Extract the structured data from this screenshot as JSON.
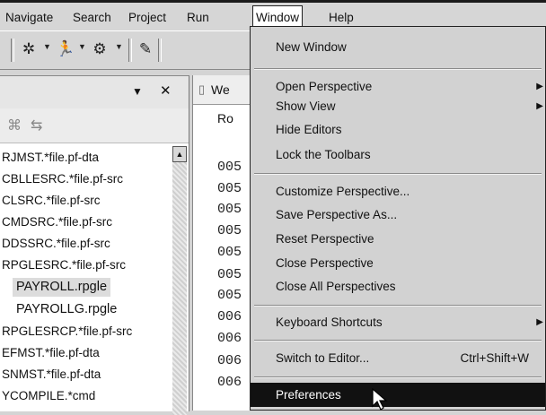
{
  "menubar": {
    "items": [
      {
        "label": "Navigate"
      },
      {
        "label": "Search"
      },
      {
        "label": "Project"
      },
      {
        "label": "Run"
      },
      {
        "label": "Window"
      },
      {
        "label": "Help"
      }
    ]
  },
  "left_view": {
    "files": [
      "RJMST.*file.pf-dta",
      "CBLLESRC.*file.pf-src",
      "CLSRC.*file.pf-src",
      "CMDSRC.*file.pf-src",
      "DDSSRC.*file.pf-src",
      "RPGLESRC.*file.pf-src",
      "PAYROLL.rpgle",
      "PAYROLLG.rpgle",
      "RPGLESRCP.*file.pf-src",
      "EFMST.*file.pf-dta",
      "SNMST.*file.pf-dta",
      "YCOMPILE.*cmd"
    ]
  },
  "editor": {
    "tab_label": "We",
    "column_header": "Ro",
    "row_numbers": [
      "005",
      "005",
      "005",
      "005",
      "005",
      "005",
      "005",
      "006",
      "006",
      "006",
      "006"
    ]
  },
  "window_menu": {
    "new_window": "New Window",
    "open_perspective": "Open Perspective",
    "show_view": "Show View",
    "hide_editors": "Hide Editors",
    "lock_toolbars": "Lock the Toolbars",
    "customize_perspective": "Customize Perspective...",
    "save_perspective_as": "Save Perspective As...",
    "reset_perspective": "Reset Perspective",
    "close_perspective": "Close Perspective",
    "close_all_perspectives": "Close All Perspectives",
    "keyboard_shortcuts": "Keyboard Shortcuts",
    "switch_to_editor": "Switch to Editor...",
    "switch_to_editor_shortcut": "Ctrl+Shift+W",
    "preferences": "Preferences"
  },
  "icons": {
    "submenu_arrow": "▶",
    "minimize": "▼",
    "close": "✕",
    "scroll_up": "▲"
  }
}
